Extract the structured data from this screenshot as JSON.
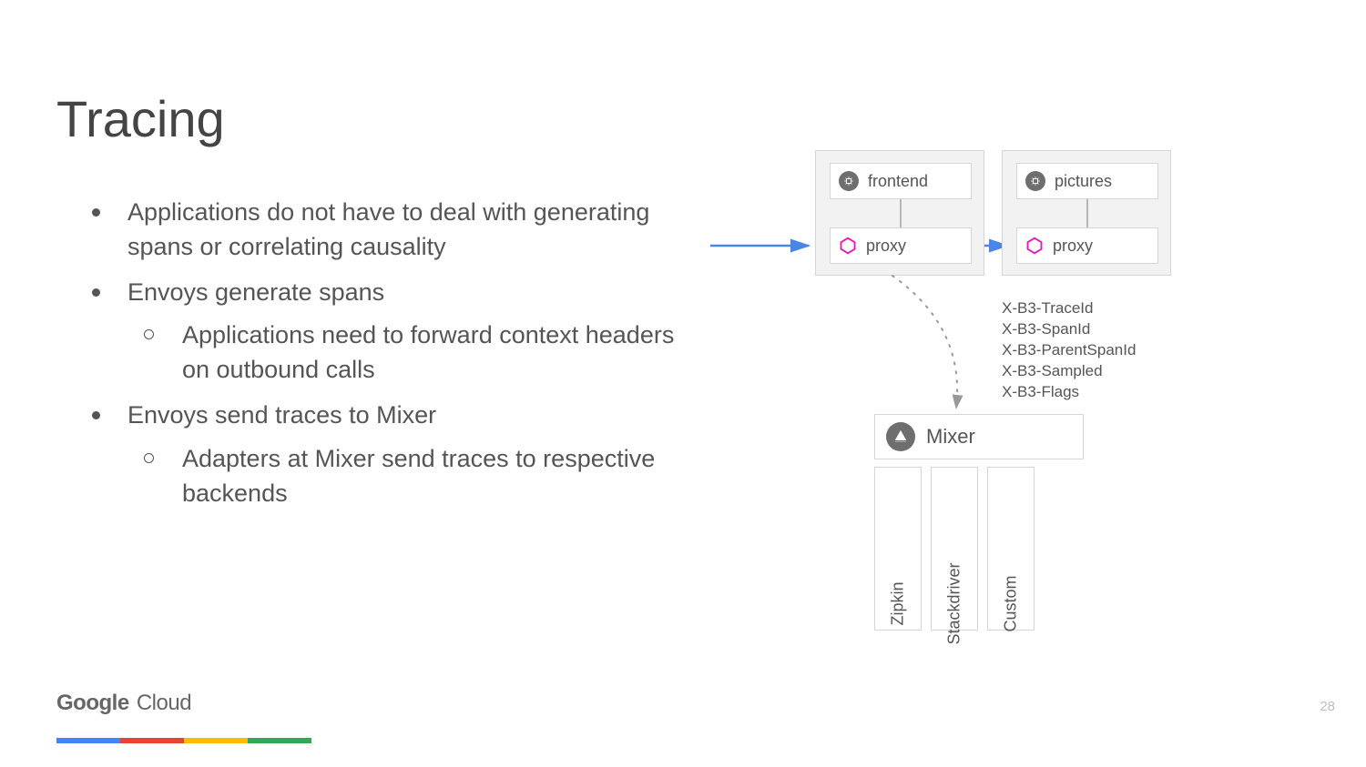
{
  "title": "Tracing",
  "bullets": {
    "b1": "Applications do not have to deal with generating spans or correlating causality",
    "b2": "Envoys generate spans",
    "b2a": "Applications need to forward context headers on outbound calls",
    "b3": "Envoys send traces to Mixer",
    "b3a": "Adapters at Mixer send traces to respective backends"
  },
  "svc1": {
    "name": "frontend",
    "proxy": "proxy"
  },
  "svc2": {
    "name": "pictures",
    "proxy": "proxy"
  },
  "headers": {
    "h1": "X-B3-TraceId",
    "h2": "X-B3-SpanId",
    "h3": "X-B3-ParentSpanId",
    "h4": "X-B3-Sampled",
    "h5": "X-B3-Flags"
  },
  "mixer": "Mixer",
  "adapters": {
    "a1": "Zipkin",
    "a2": "Stackdriver",
    "a3": "Custom"
  },
  "logo": {
    "google": "Google",
    "cloud": " Cloud"
  },
  "page": "28"
}
